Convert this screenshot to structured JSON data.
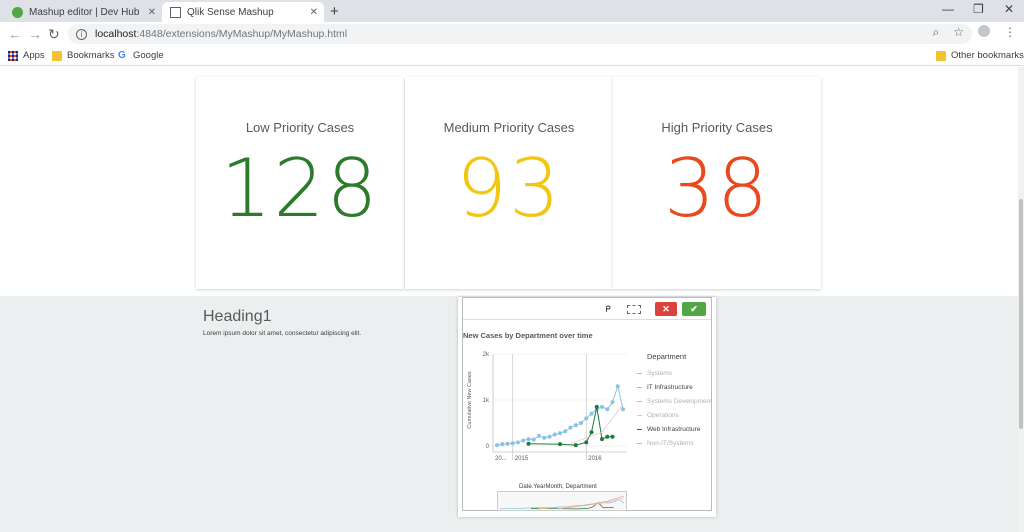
{
  "browser": {
    "tabs": [
      {
        "title": "Mashup editor | Dev Hub",
        "active": false
      },
      {
        "title": "Qlik Sense Mashup",
        "active": true
      }
    ],
    "url_host": "localhost",
    "url_path": ":4848/extensions/MyMashup/MyMashup.html",
    "bookmarks": [
      "Apps",
      "Bookmarks",
      "Google"
    ],
    "other_bookmarks": "Other bookmarks"
  },
  "kpis": [
    {
      "label": "Low Priority Cases",
      "value": "128",
      "color": "#2d7a2d"
    },
    {
      "label": "Medium Priority Cases",
      "value": "93",
      "color": "#f3c613"
    },
    {
      "label": "High Priority Cases",
      "value": "38",
      "color": "#e8491d"
    }
  ],
  "section": {
    "heading": "Heading1",
    "text": "Lorem ipsum dolor sit amet, consectetur adipiscing elit."
  },
  "chart_data": {
    "type": "line",
    "title": "New Cases by Department over time",
    "ylabel": "Cumulative New Cases",
    "xlabel": "Date.YearMonth, Department",
    "x_tick_labels": [
      "20...",
      "2015",
      "2016"
    ],
    "y_tick_labels": [
      "0",
      "1k",
      "2k"
    ],
    "ylim": [
      0,
      2000
    ],
    "legend_title": "Department",
    "legend": [
      {
        "name": "Systems",
        "color": "#e7a3b8",
        "dimmed": true
      },
      {
        "name": "IT Infrastructure",
        "color": "#88c4e4",
        "dimmed": false
      },
      {
        "name": "Systems Development",
        "color": "#e7a3c8",
        "dimmed": true
      },
      {
        "name": "Operations",
        "color": "#f2c5a0",
        "dimmed": true
      },
      {
        "name": "Web Infrastructure",
        "color": "#1e7a3a",
        "dimmed": false
      },
      {
        "name": "Non-IT/Systems",
        "color": "#e9a6b0",
        "dimmed": true
      }
    ],
    "series": [
      {
        "name": "IT Infrastructure",
        "color": "#88c4e4",
        "values": [
          20,
          40,
          50,
          60,
          80,
          120,
          150,
          140,
          220,
          180,
          200,
          250,
          280,
          320,
          400,
          450,
          500,
          600,
          700,
          800,
          850,
          800,
          950,
          1300,
          800
        ]
      },
      {
        "name": "Web Infrastructure",
        "color": "#1e7a3a",
        "values": [
          null,
          null,
          null,
          null,
          null,
          null,
          50,
          null,
          null,
          null,
          null,
          null,
          40,
          null,
          null,
          20,
          null,
          80,
          300,
          850,
          150,
          200,
          200,
          null,
          null
        ]
      }
    ]
  }
}
